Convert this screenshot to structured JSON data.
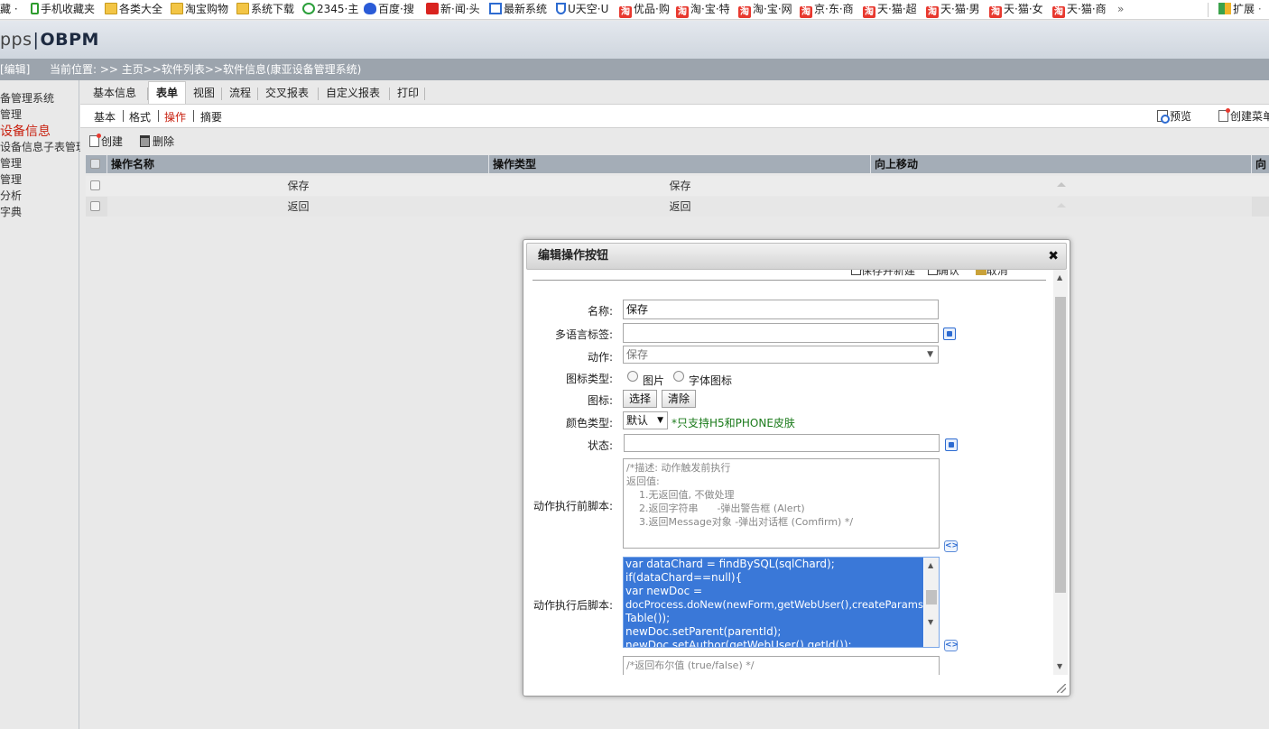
{
  "bookmarks": [
    {
      "label": "藏 ·",
      "icon": "bookmark-icon"
    },
    {
      "label": "手机收藏夹",
      "icon": "phone-icon"
    },
    {
      "label": "各类大全",
      "icon": "folder-icon"
    },
    {
      "label": "淘宝购物",
      "icon": "folder-icon"
    },
    {
      "label": "系统下载",
      "icon": "folder-icon"
    },
    {
      "label": "2345·主",
      "icon": "2345-icon"
    },
    {
      "label": "百度·搜",
      "icon": "paw-icon"
    },
    {
      "label": "新·闻·头",
      "icon": "news-icon"
    },
    {
      "label": "最新系统",
      "icon": "house-icon"
    },
    {
      "label": "U天空·U",
      "icon": "u-icon"
    },
    {
      "label": "优品·购",
      "icon": "tao-icon"
    },
    {
      "label": "淘·宝·特",
      "icon": "tao-icon"
    },
    {
      "label": "淘·宝·网",
      "icon": "tao-icon"
    },
    {
      "label": "京·东·商",
      "icon": "tao-icon"
    },
    {
      "label": "天·猫·超",
      "icon": "tao-icon"
    },
    {
      "label": "天·猫·男",
      "icon": "tao-icon"
    },
    {
      "label": "天·猫·女",
      "icon": "tao-icon"
    },
    {
      "label": "天·猫·商",
      "icon": "tao-icon"
    }
  ],
  "bookmarks_more": "»",
  "extensions_label": "扩展",
  "header": {
    "logo_prefix": "pps",
    "logo_sep": "|",
    "logo_main": "OBPM"
  },
  "breadcrumb": {
    "edit_label": "[编辑]",
    "location": "当前位置: >> 主页>>软件列表>>软件信息(康亚设备管理系统)"
  },
  "sidebar": {
    "items": [
      "备管理系统",
      "管理",
      "设备信息",
      "设备信息子表管理",
      "管理",
      "管理",
      "分析",
      "字典"
    ]
  },
  "tabs": [
    "基本信息",
    "表单",
    "视图",
    "流程",
    "交叉报表",
    "自定义报表",
    "打印"
  ],
  "subtabs": [
    "基本",
    "格式",
    "操作",
    "摘要"
  ],
  "toolbar": {
    "create": "创建",
    "delete": "删除",
    "preview": "预览",
    "create_menu": "创建菜单"
  },
  "grid": {
    "columns": [
      "操作名称",
      "操作类型",
      "向上移动",
      "向"
    ],
    "rows": [
      {
        "name": "保存",
        "type": "保存"
      },
      {
        "name": "返回",
        "type": "返回"
      }
    ]
  },
  "dialog": {
    "title": "编辑操作按钮",
    "close": "✖",
    "top_actions": [
      "保存并新建",
      "确认",
      "取消"
    ],
    "fields": {
      "name_label": "名称:",
      "name_value": "保存",
      "i18n_label": "多语言标签:",
      "action_label": "动作:",
      "action_value": "保存",
      "icon_type_label": "图标类型:",
      "icon_type_opt1": "图片",
      "icon_type_opt2": "字体图标",
      "icon_label": "图标:",
      "icon_select": "选择",
      "icon_clear": "清除",
      "color_label": "颜色类型:",
      "color_value": "默认",
      "color_hint": "*只支持H5和PHONE皮肤",
      "status_label": "状态:",
      "before_label": "动作执行前脚本:",
      "before_script": "/*描述: 动作触发前执行\n返回值:\n    1.无返回值, 不做处理\n    2.返回字符串      -弹出警告框 (Alert)\n    3.返回Message对象 -弹出对话框 (Comfirm) */",
      "after_label": "动作执行后脚本:",
      "after_lines": [
        "var dataChard = findBySQL(sqlChard);",
        "if(dataChard==null){",
        "var newDoc =",
        "docProcess.doNew(newForm,getWebUser(),createParams",
        "Table());",
        "newDoc.setParent(parentId);",
        "newDoc.setAuthor(getWebUser().getId());"
      ],
      "bool_script": "/*返回布尔值 (true/false) */"
    }
  }
}
